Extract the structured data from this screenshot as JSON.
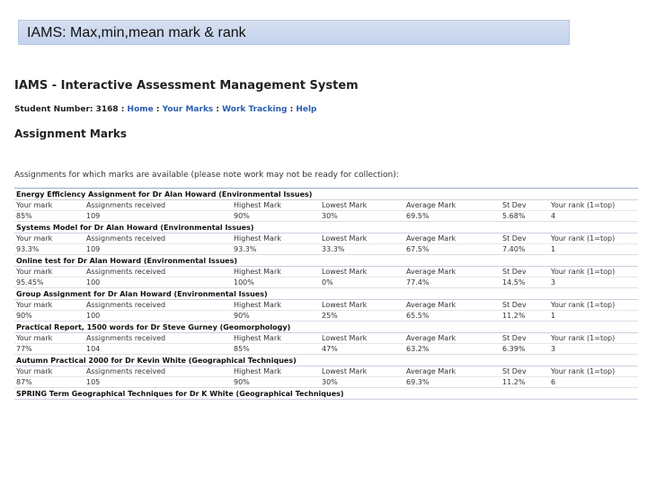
{
  "slide": {
    "title": "IAMS: Max,min,mean mark & rank"
  },
  "system": {
    "title": "IAMS - Interactive Assessment Management System",
    "student_label": "Student Number: 3168",
    "separator": " : ",
    "nav": [
      "Home",
      "Your Marks",
      "Work Tracking",
      "Help"
    ]
  },
  "page": {
    "heading": "Assignment Marks",
    "intro": "Assignments for which marks are available (please note work may not be ready for collection):"
  },
  "columns": [
    "Your mark",
    "Assignments received",
    "Highest Mark",
    "Lowest Mark",
    "Average Mark",
    "St Dev",
    "Your rank (1=top)"
  ],
  "assignments": [
    {
      "title": "Energy Efficiency Assignment for Dr Alan Howard (Environmental Issues)",
      "values": [
        "85%",
        "109",
        "90%",
        "30%",
        "69.5%",
        "5.68%",
        "4"
      ]
    },
    {
      "title": "Systems Model for Dr Alan Howard (Environmental Issues)",
      "values": [
        "93.3%",
        "109",
        "93.3%",
        "33.3%",
        "67.5%",
        "7.40%",
        "1"
      ]
    },
    {
      "title": "Online test for Dr Alan Howard (Environmental Issues)",
      "values": [
        "95.45%",
        "100",
        "100%",
        "0%",
        "77.4%",
        "14.5%",
        "3"
      ]
    },
    {
      "title": "Group Assignment for Dr Alan Howard (Environmental Issues)",
      "values": [
        "90%",
        "100",
        "90%",
        "25%",
        "65.5%",
        "11.2%",
        "1"
      ]
    },
    {
      "title": "Practical Report, 1500 words for Dr Steve Gurney (Geomorphology)",
      "values": [
        "77%",
        "104",
        "85%",
        "47%",
        "63.2%",
        "6.39%",
        "3"
      ]
    },
    {
      "title": "Autumn Practical 2000 for Dr Kevin White (Geographical Techniques)",
      "values": [
        "87%",
        "105",
        "90%",
        "30%",
        "69.3%",
        "11.2%",
        "6"
      ]
    },
    {
      "title": "SPRING Term Geographical Techniques for Dr K White (Geographical Techniques)",
      "values": null
    }
  ]
}
